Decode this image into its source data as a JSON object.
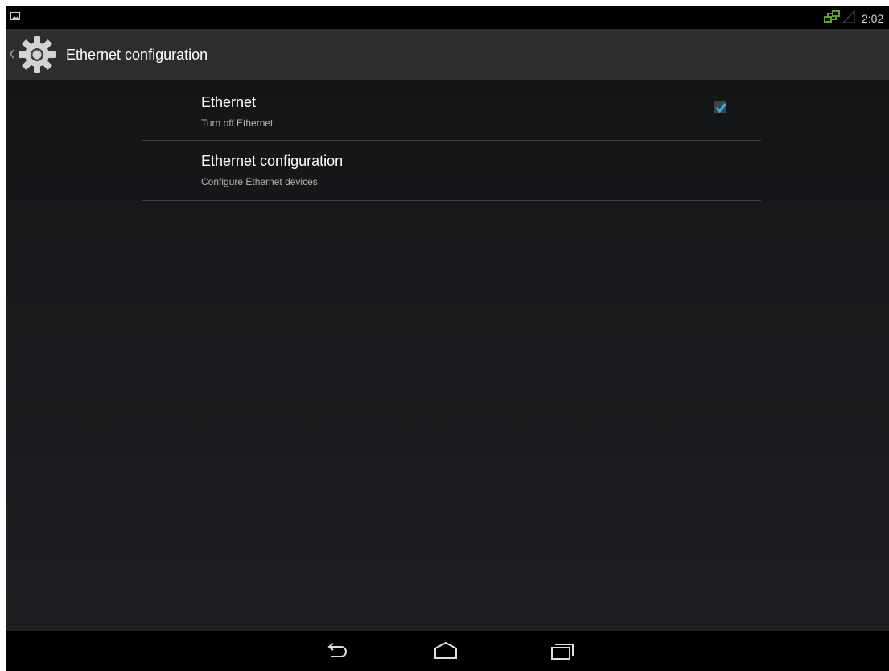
{
  "status_bar": {
    "time": "2:02",
    "icons": [
      "image-notification-icon",
      "ethernet-icon",
      "signal-icon"
    ],
    "ethernet_icon_color": "#5aa620"
  },
  "action_bar": {
    "title": "Ethernet configuration",
    "icons": [
      "back-caret-icon",
      "settings-gear-icon"
    ]
  },
  "preferences": [
    {
      "title": "Ethernet",
      "summary": "Turn off Ethernet",
      "checked": true,
      "checkbox_color": "#33b5e5"
    },
    {
      "title": "Ethernet configuration",
      "summary": "Configure Ethernet devices"
    }
  ],
  "nav_bar": {
    "buttons": [
      "back-icon",
      "home-icon",
      "recent-apps-icon"
    ]
  }
}
